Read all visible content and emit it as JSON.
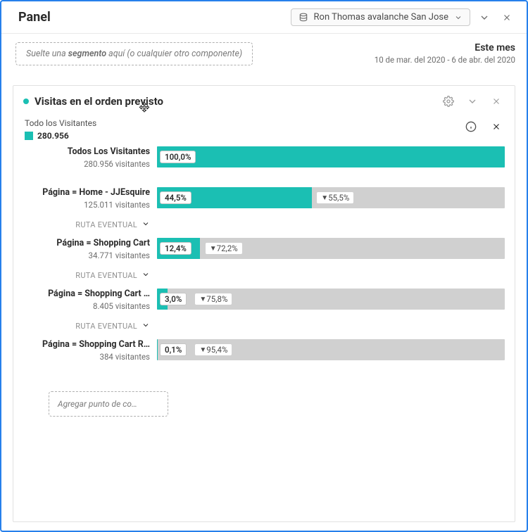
{
  "header": {
    "title": "Panel",
    "suite_label": "Ron Thomas avalanche San Jose"
  },
  "segment_drop": {
    "pre": "Suelte una ",
    "em": "segmento",
    "post": " aquí (o cualquier otro componente)"
  },
  "date": {
    "range_name": "Este mes",
    "range_dates": "10 de mar. del 2020 - 6 de abr. del 2020"
  },
  "card": {
    "title": "Visitas en el orden previsto",
    "legend_label": "Todo los Visitantes",
    "legend_value": "280.956"
  },
  "path_label": "RUTA EVENTUAL",
  "add_point_label": "Agregar punto de co…",
  "chart_data": {
    "type": "bar",
    "orientation": "horizontal",
    "title": "Visitas en el orden previsto",
    "xlabel": "",
    "ylabel": "",
    "xlim": [
      0,
      100
    ],
    "series_name": "Todo los Visitantes",
    "series_total": 280956,
    "steps": [
      {
        "name": "Todos Los Visitantes",
        "visitors": "280.956 visitantes",
        "pct": 100.0,
        "pct_label": "100,0%",
        "drop_pct": null,
        "drop_label": null,
        "has_path": false
      },
      {
        "name": "Página = Home - JJEsquire",
        "visitors": "125.011 visitantes",
        "pct": 44.5,
        "pct_label": "44,5%",
        "drop_pct": 55.5,
        "drop_label": "55,5%",
        "has_path": true
      },
      {
        "name": "Página = Shopping Cart",
        "visitors": "34.771 visitantes",
        "pct": 12.4,
        "pct_label": "12,4%",
        "drop_pct": 72.2,
        "drop_label": "72,2%",
        "has_path": true
      },
      {
        "name": "Página = Shopping Cart …",
        "visitors": "8.405 visitantes",
        "pct": 3.0,
        "pct_label": "3,0%",
        "drop_pct": 75.8,
        "drop_label": "75,8%",
        "has_path": true
      },
      {
        "name": "Página = Shopping Cart R…",
        "visitors": "384 visitantes",
        "pct": 0.1,
        "pct_label": "0,1%",
        "drop_pct": 95.4,
        "drop_label": "95,4%",
        "has_path": false
      }
    ]
  }
}
